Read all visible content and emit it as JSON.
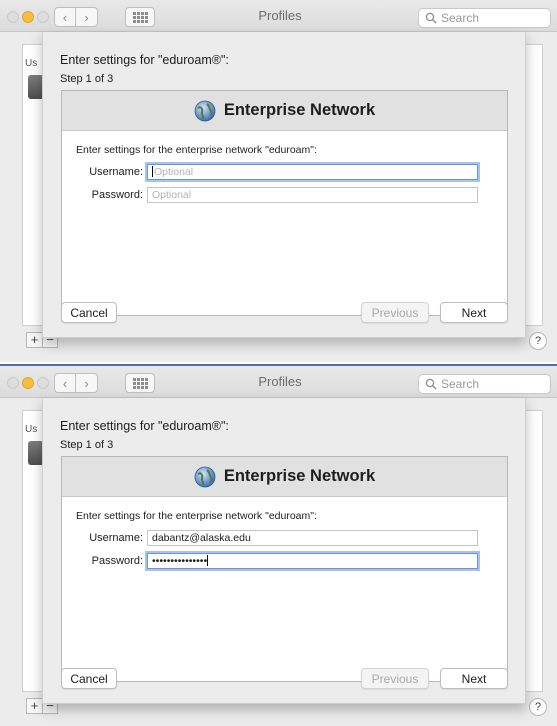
{
  "window": {
    "title": "Profiles",
    "search_placeholder": "Search",
    "add_label": "+",
    "remove_label": "−",
    "help_label": "?",
    "list_partial_label": "Us"
  },
  "panels": [
    {
      "sheet_title": "Enter settings for \"eduroam®\":",
      "step": "Step 1 of 3",
      "header": "Enterprise Network",
      "prompt": "Enter settings for the enterprise network \"eduroam\":",
      "username_label": "Username:",
      "username_value": "",
      "username_placeholder": "Optional",
      "password_label": "Password:",
      "password_value": "",
      "password_placeholder": "Optional",
      "focused_field": "username",
      "cancel_label": "Cancel",
      "previous_label": "Previous",
      "next_label": "Next"
    },
    {
      "sheet_title": "Enter settings for \"eduroam®\":",
      "step": "Step 1 of 3",
      "header": "Enterprise Network",
      "prompt": "Enter settings for the enterprise network \"eduroam\":",
      "username_label": "Username:",
      "username_value": "dabantz@alaska.edu",
      "username_placeholder": "",
      "password_label": "Password:",
      "password_value": "•••••••••••••••",
      "password_placeholder": "",
      "focused_field": "password",
      "cancel_label": "Cancel",
      "previous_label": "Previous",
      "next_label": "Next"
    }
  ],
  "colors": {
    "focus_ring": "#a8c3ee",
    "minimize_button": "#f5be3f",
    "divider": "#4a6ea8"
  },
  "icons": {
    "header_icon": "globe-icon",
    "search_icon": "magnifier-icon"
  }
}
